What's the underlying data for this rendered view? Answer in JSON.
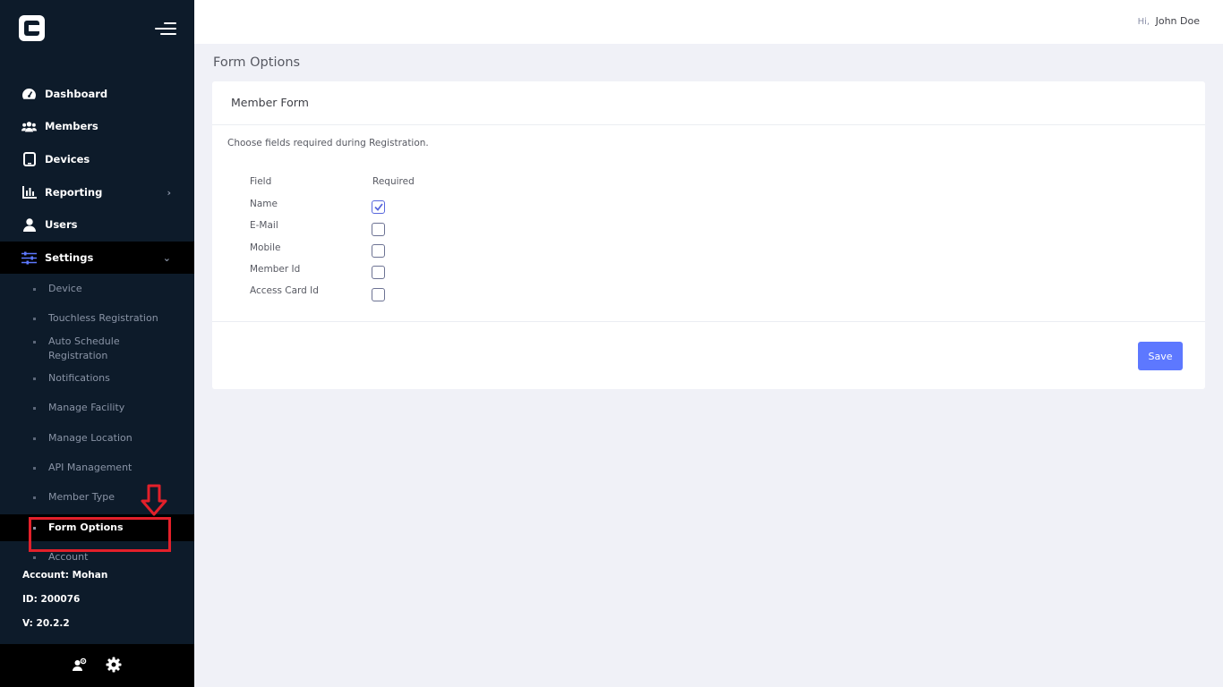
{
  "header": {
    "greeting_prefix": "Hi,",
    "user_name": "John Doe"
  },
  "sidebar": {
    "items": [
      {
        "label": "Dashboard",
        "icon": "dashboard-icon"
      },
      {
        "label": "Members",
        "icon": "users-group-icon"
      },
      {
        "label": "Devices",
        "icon": "tablet-icon"
      },
      {
        "label": "Reporting",
        "icon": "bar-chart-icon",
        "arrow": "›"
      },
      {
        "label": "Users",
        "icon": "user-icon"
      },
      {
        "label": "Settings",
        "icon": "sliders-icon",
        "arrow": "⌄",
        "active": true
      }
    ],
    "settings_subitems": [
      "Device",
      "Touchless Registration",
      "Auto Schedule Registration",
      "Notifications",
      "Manage Facility",
      "Manage Location",
      "API Management",
      "Member Type",
      "Form Options",
      "Account"
    ],
    "active_subitem": "Form Options",
    "account_info": {
      "account": "Account: Mohan",
      "id": "ID: 200076",
      "version": "V: 20.2.2"
    },
    "bottom_icons": [
      "user-settings-icon",
      "gear-icon"
    ]
  },
  "main": {
    "page_title": "Form Options",
    "card": {
      "title": "Member Form",
      "description": "Choose fields required during Registration.",
      "columns": {
        "field": "Field",
        "required": "Required"
      },
      "rows": [
        {
          "field": "Name",
          "required": true
        },
        {
          "field": "E-Mail",
          "required": false
        },
        {
          "field": "Mobile",
          "required": false
        },
        {
          "field": "Member Id",
          "required": false
        },
        {
          "field": "Access Card Id",
          "required": false
        }
      ],
      "save_label": "Save"
    }
  },
  "annotation": {
    "highlight_color": "#e3202a",
    "arrow_icon": "down-arrow-icon"
  },
  "colors": {
    "sidebar_bg": "#0d1b2a",
    "accent": "#5d78ff",
    "page_bg": "#f0f1f7"
  }
}
